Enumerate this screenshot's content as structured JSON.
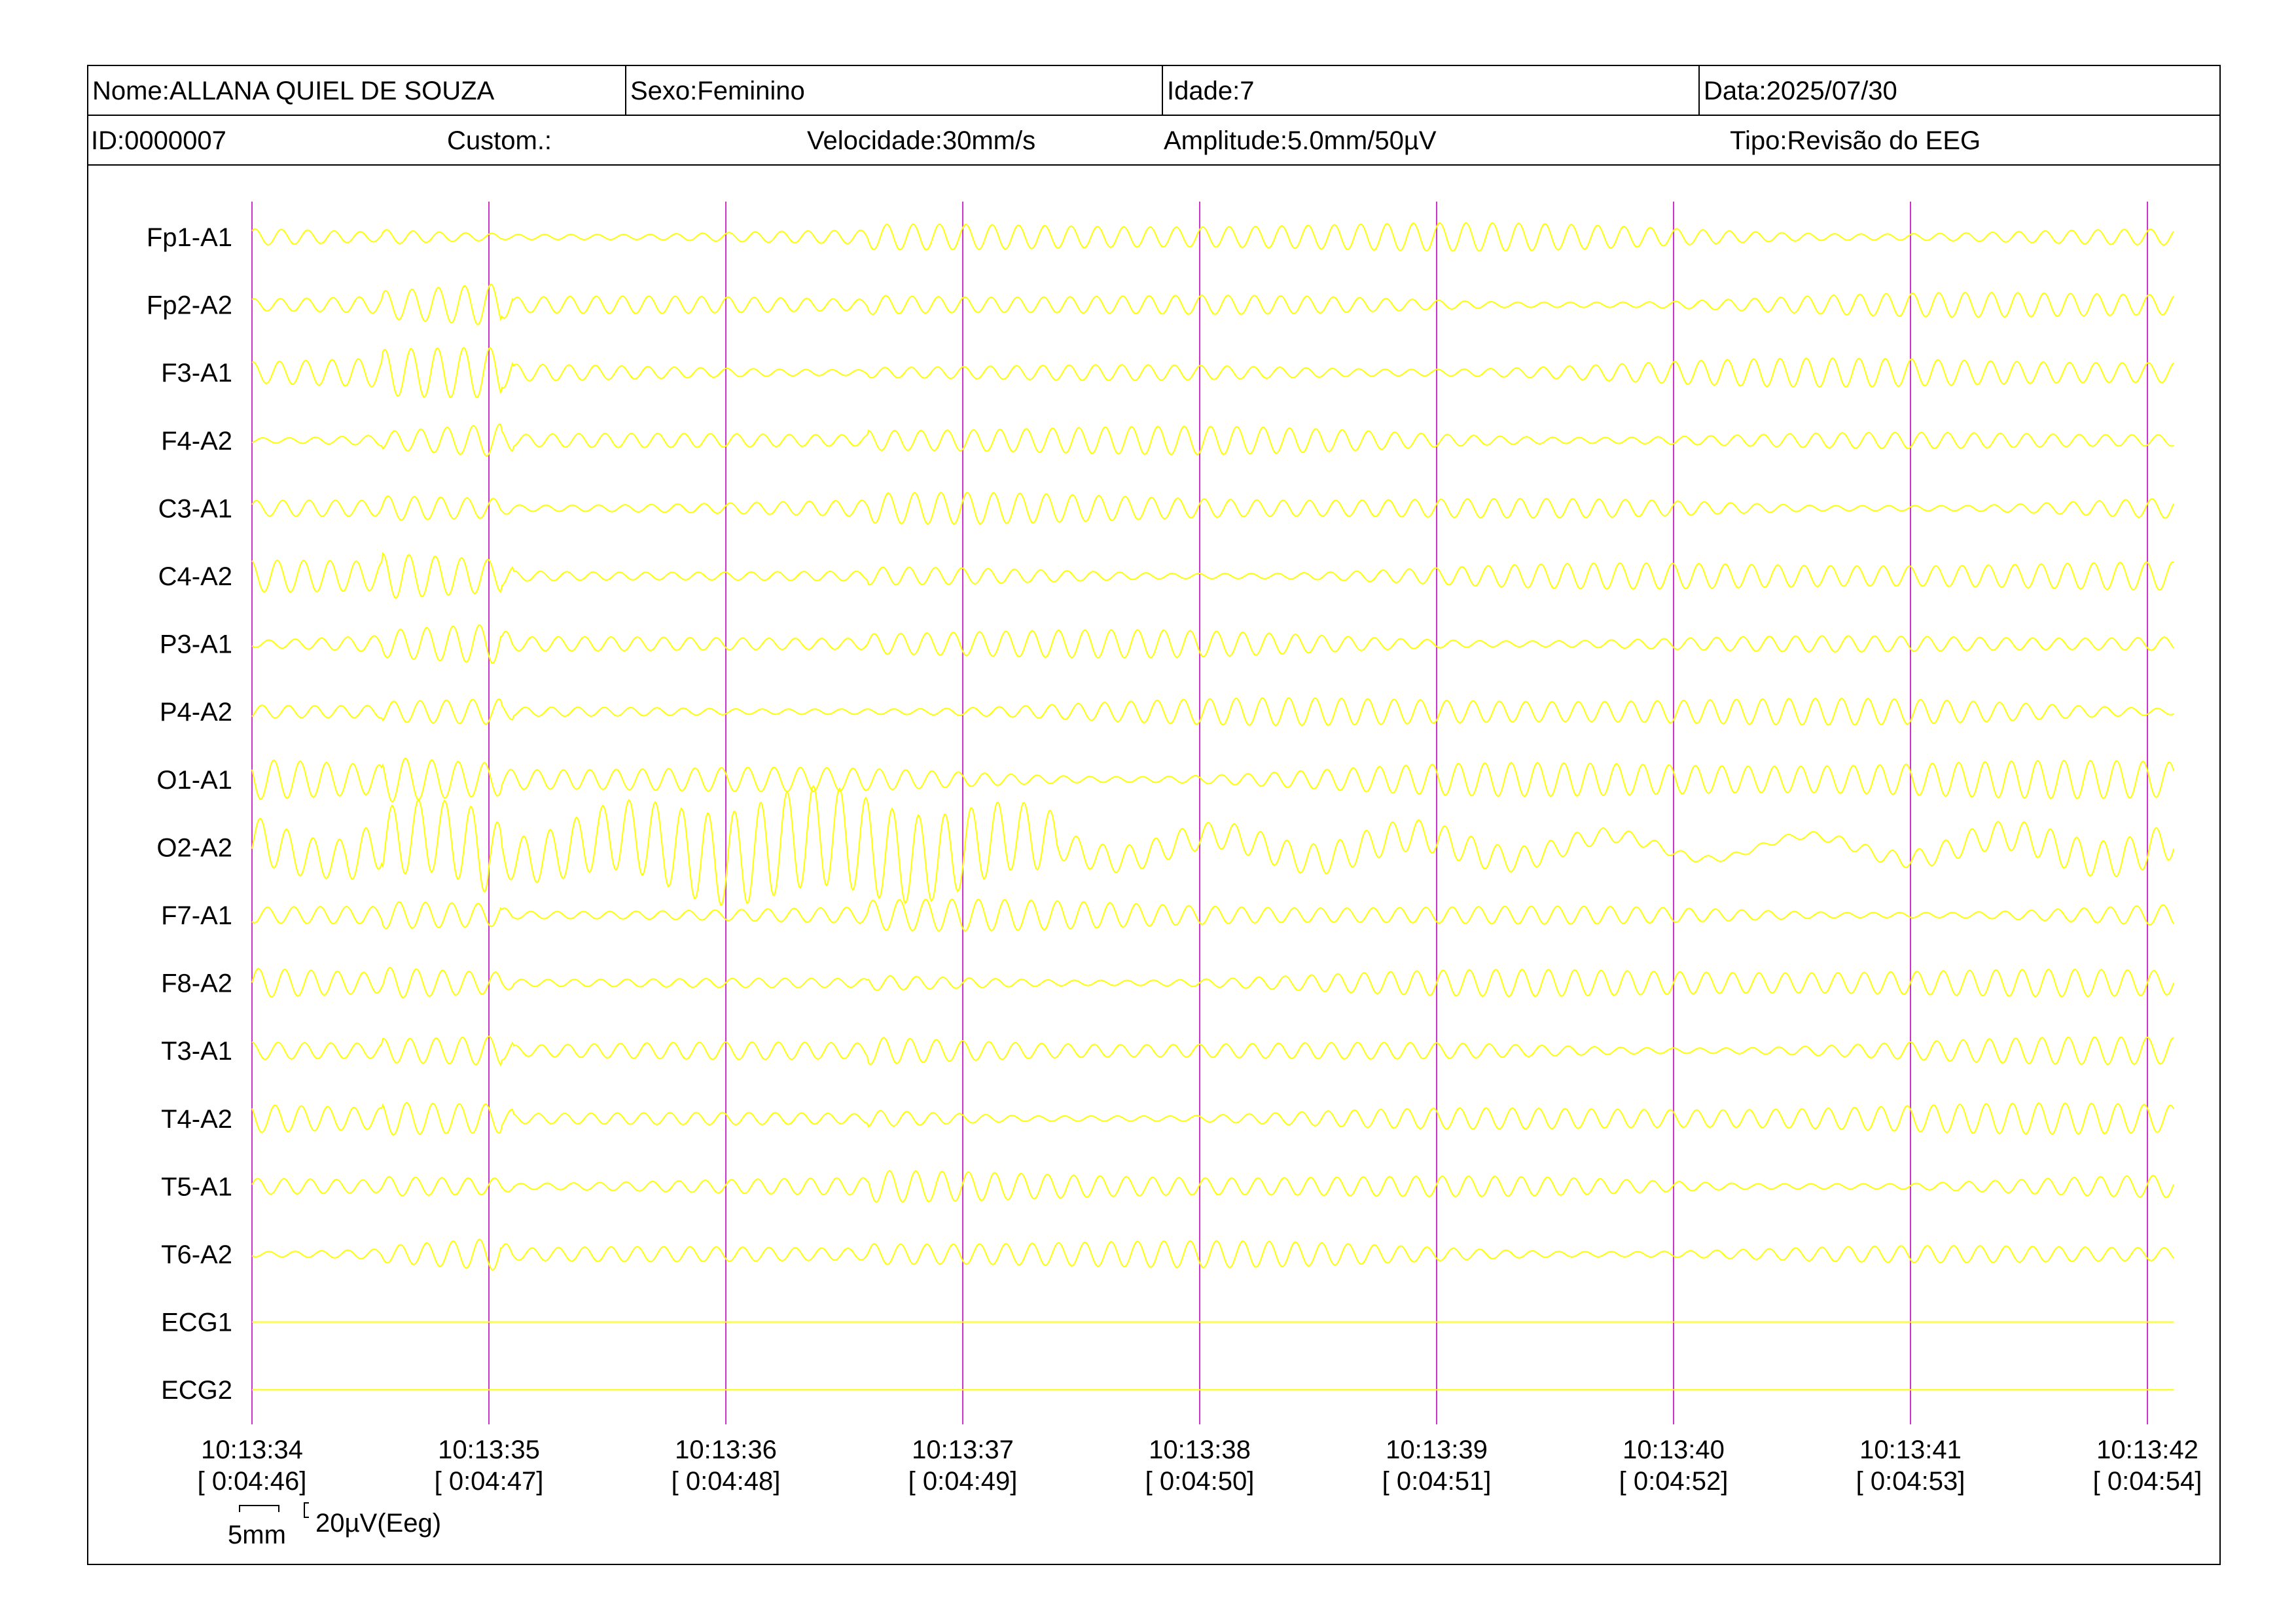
{
  "header": {
    "nome": "Nome:ALLANA QUIEL DE SOUZA",
    "sexo": "Sexo:Feminino",
    "idade": "Idade:7",
    "data": "Data:2025/07/30",
    "id": "ID:0000007",
    "custom": "Custom.:",
    "velocidade": "Velocidade:30mm/s",
    "amplitude": "Amplitude:5.0mm/50µV",
    "tipo": "Tipo:Revisão do EEG"
  },
  "colors": {
    "trace": "#ffff00",
    "second_marker": "#cc33cc",
    "border": "#000000",
    "background": "#ffffff"
  },
  "scale_bar": {
    "time_label": "5mm",
    "amplitude_label": "20µV(Eeg)"
  },
  "chart_data": {
    "type": "line",
    "channels": [
      "Fp1-A1",
      "Fp2-A2",
      "F3-A1",
      "F4-A2",
      "C3-A1",
      "C4-A2",
      "P3-A1",
      "P4-A2",
      "O1-A1",
      "O2-A2",
      "F7-A1",
      "F8-A2",
      "T3-A1",
      "T4-A2",
      "T5-A1",
      "T6-A2",
      "ECG1",
      "ECG2"
    ],
    "time_ticks": [
      {
        "clock": "10:13:34",
        "elapsed": "[ 0:04:46]"
      },
      {
        "clock": "10:13:35",
        "elapsed": "[ 0:04:47]"
      },
      {
        "clock": "10:13:36",
        "elapsed": "[ 0:04:48]"
      },
      {
        "clock": "10:13:37",
        "elapsed": "[ 0:04:49]"
      },
      {
        "clock": "10:13:38",
        "elapsed": "[ 0:04:50]"
      },
      {
        "clock": "10:13:39",
        "elapsed": "[ 0:04:51]"
      },
      {
        "clock": "10:13:40",
        "elapsed": "[ 0:04:52]"
      },
      {
        "clock": "10:13:41",
        "elapsed": "[ 0:04:53]"
      },
      {
        "clock": "10:13:42",
        "elapsed": "[ 0:04:54]"
      }
    ],
    "xlim_seconds": [
      0,
      8.1
    ],
    "dominant_frequency_hz": 9,
    "grid": "vertical second markers",
    "legend": "none"
  }
}
